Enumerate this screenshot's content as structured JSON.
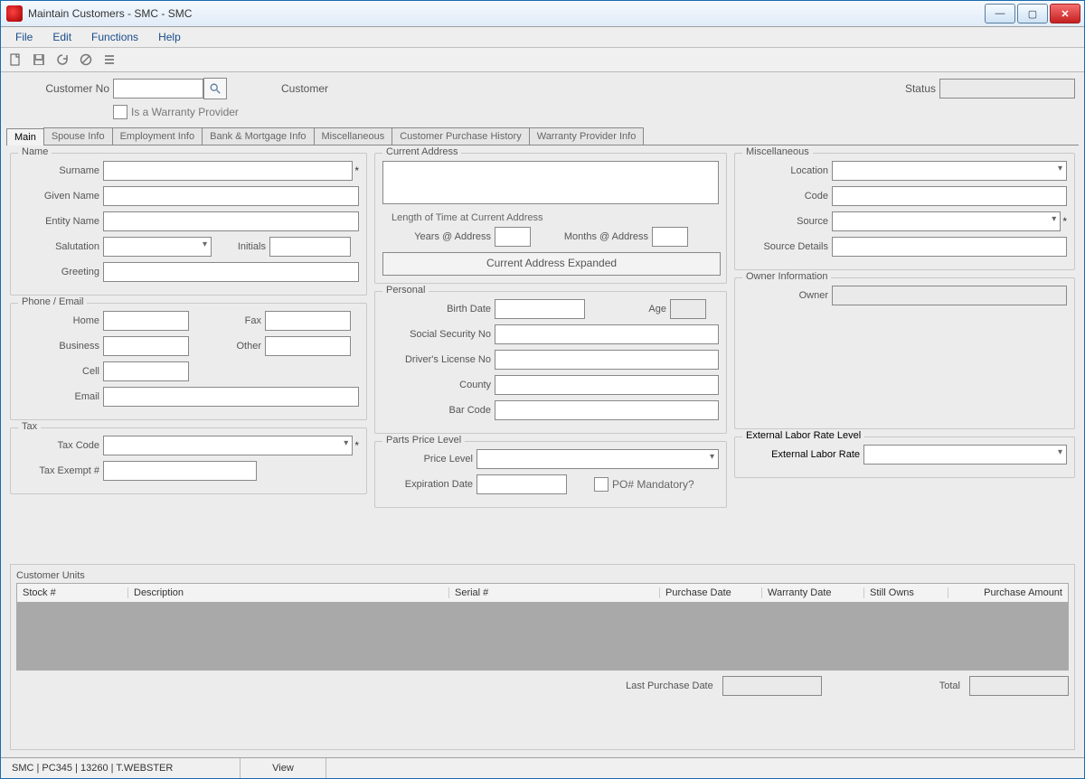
{
  "window": {
    "title": "Maintain Customers - SMC - SMC"
  },
  "menu": {
    "file": "File",
    "edit": "Edit",
    "functions": "Functions",
    "help": "Help"
  },
  "toolbar": {
    "icons": {
      "new": "new-icon",
      "save": "save-icon",
      "refresh": "refresh-icon",
      "cancel": "cancel-icon",
      "list": "list-icon"
    }
  },
  "header": {
    "customer_no_label": "Customer No",
    "customer_no_value": "",
    "customer_label": "Customer",
    "customer_value": "",
    "status_label": "Status",
    "status_value": "",
    "warranty_provider_label": "Is a Warranty Provider",
    "warranty_provider_checked": false
  },
  "tabs": [
    {
      "label": "Main",
      "active": true
    },
    {
      "label": "Spouse Info",
      "active": false
    },
    {
      "label": "Employment Info",
      "active": false
    },
    {
      "label": "Bank & Mortgage Info",
      "active": false
    },
    {
      "label": "Miscellaneous",
      "active": false
    },
    {
      "label": "Customer Purchase History",
      "active": false
    },
    {
      "label": "Warranty Provider Info",
      "active": false
    }
  ],
  "name": {
    "legend": "Name",
    "surname_label": "Surname",
    "surname": "",
    "given_label": "Given Name",
    "given": "",
    "entity_label": "Entity Name",
    "entity": "",
    "salutation_label": "Salutation",
    "salutation": "",
    "initials_label": "Initials",
    "initials": "",
    "greeting_label": "Greeting",
    "greeting": ""
  },
  "phone": {
    "legend": "Phone / Email",
    "home_label": "Home",
    "home": "",
    "fax_label": "Fax",
    "fax": "",
    "business_label": "Business",
    "business": "",
    "other_label": "Other",
    "other": "",
    "cell_label": "Cell",
    "cell": "",
    "email_label": "Email",
    "email": ""
  },
  "tax": {
    "legend": "Tax",
    "code_label": "Tax Code",
    "code": "",
    "exempt_label": "Tax Exempt #",
    "exempt": ""
  },
  "address": {
    "legend": "Current Address",
    "value": "",
    "length_legend": "Length of Time at Current Address",
    "years_label": "Years @ Address",
    "years": "",
    "months_label": "Months @ Address",
    "months": "",
    "expand_btn": "Current Address Expanded"
  },
  "personal": {
    "legend": "Personal",
    "birth_label": "Birth Date",
    "birth": "",
    "age_label": "Age",
    "age": "",
    "ssn_label": "Social Security No",
    "ssn": "",
    "dl_label": "Driver's License No",
    "dl": "",
    "county_label": "County",
    "county": "",
    "barcode_label": "Bar Code",
    "barcode": ""
  },
  "price": {
    "legend": "Parts Price Level",
    "level_label": "Price Level",
    "level": "",
    "exp_label": "Expiration Date",
    "exp": "",
    "po_label": "PO# Mandatory?",
    "po_checked": false
  },
  "misc": {
    "legend": "Miscellaneous",
    "location_label": "Location",
    "location": "",
    "code_label": "Code",
    "code": "",
    "source_label": "Source",
    "source": "",
    "source_details_label": "Source Details",
    "source_details": ""
  },
  "owner": {
    "legend": "Owner Information",
    "owner_label": "Owner",
    "owner": ""
  },
  "elr": {
    "legend": "External Labor Rate Level",
    "rate_label": "External Labor Rate",
    "rate": ""
  },
  "units": {
    "legend": "Customer Units",
    "cols": {
      "stock": "Stock #",
      "desc": "Description",
      "serial": "Serial #",
      "purchase": "Purchase Date",
      "warranty": "Warranty Date",
      "owns": "Still Owns",
      "amount": "Purchase Amount"
    },
    "last_label": "Last Purchase Date",
    "last": "",
    "total_label": "Total",
    "total": ""
  },
  "status": {
    "info": "SMC | PC345 | 13260 | T.WEBSTER",
    "mode": "View"
  }
}
